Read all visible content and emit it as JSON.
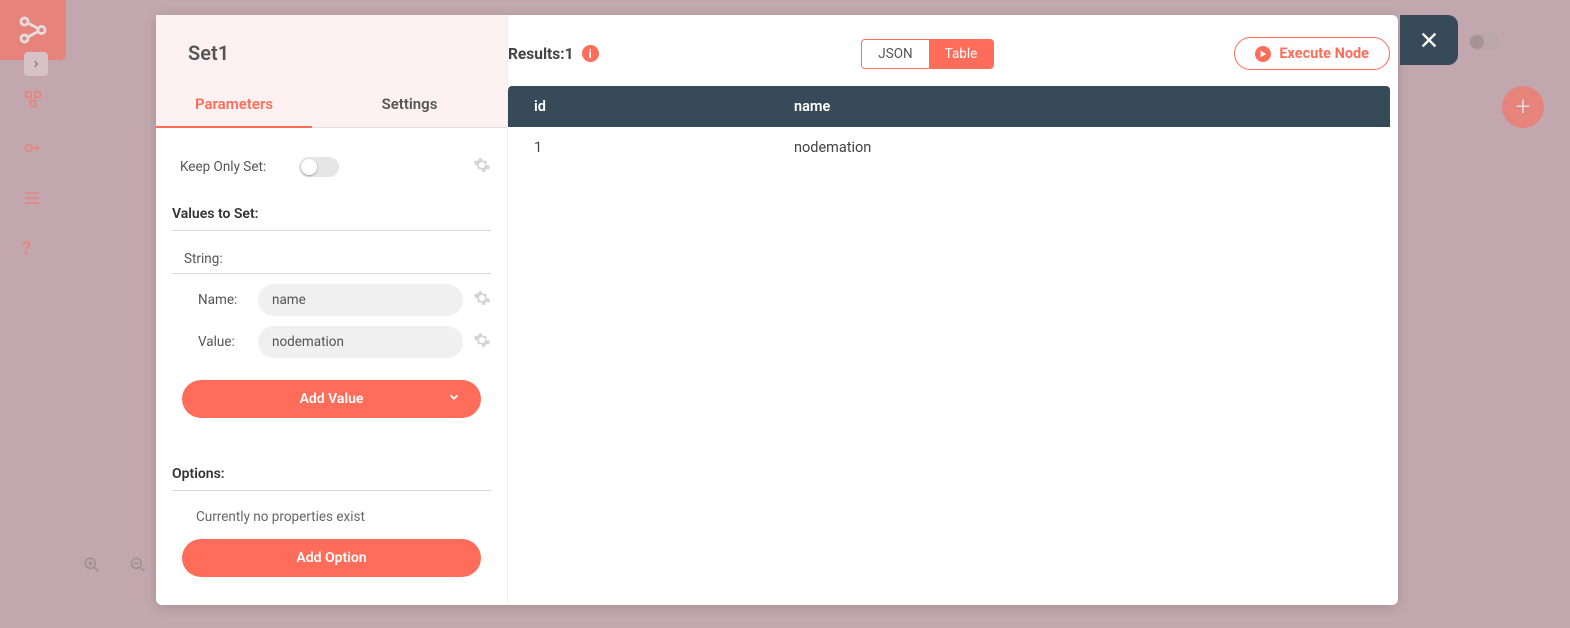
{
  "node": {
    "title": "Set1",
    "tabs": {
      "parameters": "Parameters",
      "settings": "Settings"
    },
    "keep_only_set_label": "Keep Only Set:",
    "values_to_set_label": "Values to Set:",
    "string_label": "String:",
    "name_label": "Name:",
    "value_label": "Value:",
    "name_input": "name",
    "value_input": "nodemation",
    "add_value_label": "Add Value",
    "options_label": "Options:",
    "no_properties_text": "Currently no properties exist",
    "add_option_label": "Add Option"
  },
  "results": {
    "label_prefix": "Results: ",
    "count": "1",
    "view_json": "JSON",
    "view_table": "Table",
    "execute_label": "Execute Node",
    "columns": [
      "id",
      "name"
    ],
    "rows": [
      {
        "id": "1",
        "name": "nodemation"
      }
    ]
  }
}
